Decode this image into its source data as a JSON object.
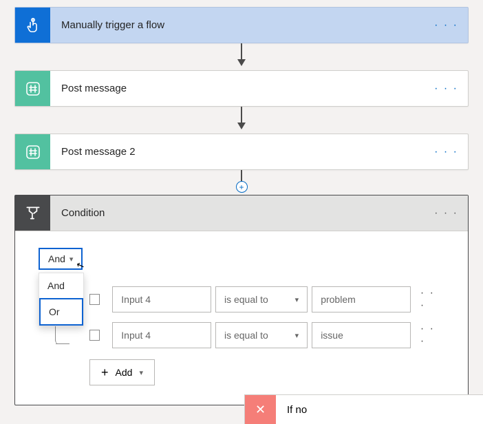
{
  "steps": [
    {
      "title": "Manually trigger a flow"
    },
    {
      "title": "Post message"
    },
    {
      "title": "Post message 2"
    }
  ],
  "condition": {
    "title": "Condition",
    "group_operator": "And",
    "dropdown_options": [
      "And",
      "Or"
    ],
    "rows": [
      {
        "value": "Input 4",
        "operator": "is equal to",
        "compare": "problem"
      },
      {
        "value": "Input 4",
        "operator": "is equal to",
        "compare": "issue"
      }
    ],
    "add_label": "Add"
  },
  "branches": {
    "no_label": "If no"
  }
}
